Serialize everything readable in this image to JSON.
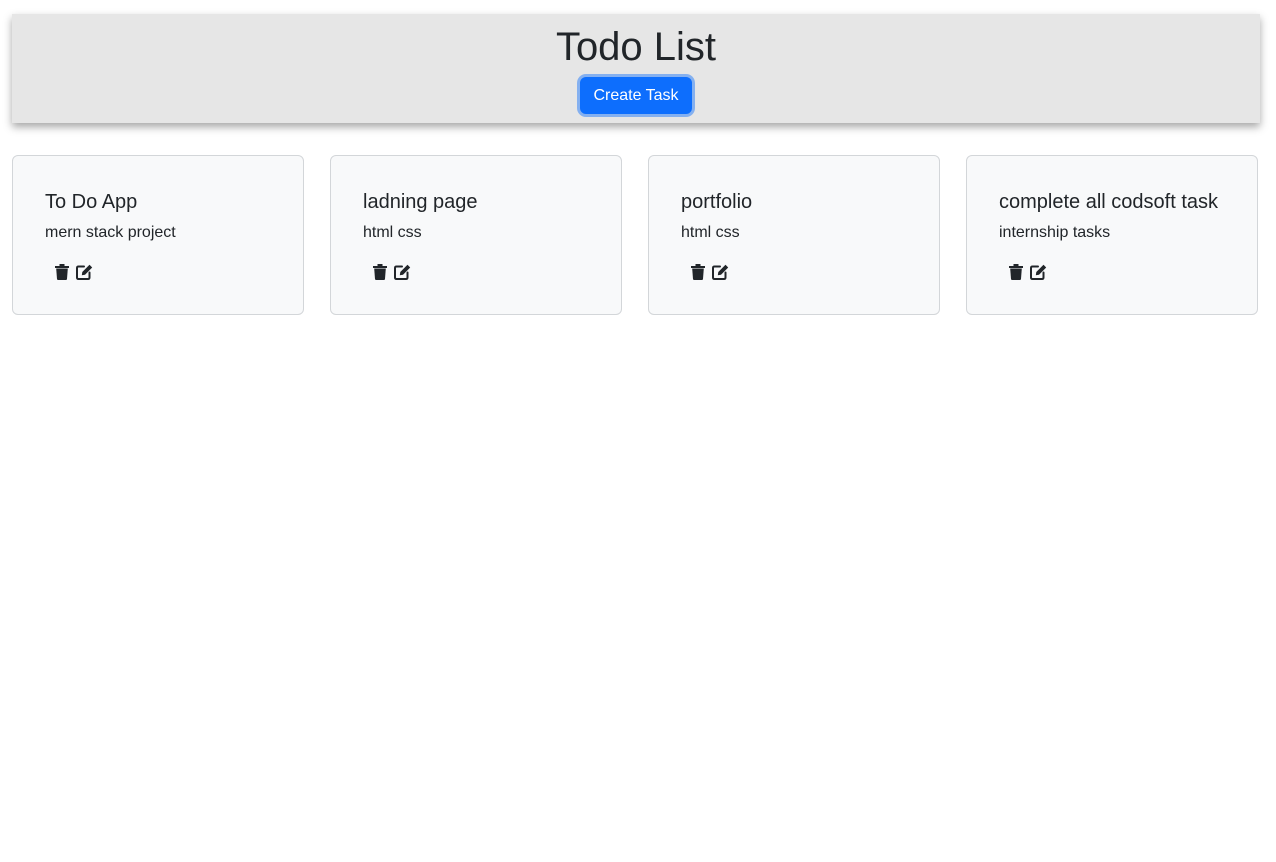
{
  "header": {
    "title": "Todo List",
    "create_button_label": "Create Task"
  },
  "tasks": [
    {
      "title": "To Do App",
      "description": "mern stack project",
      "delete_icon": "trash-icon",
      "edit_icon": "edit-icon"
    },
    {
      "title": "ladning page",
      "description": "html css",
      "delete_icon": "trash-icon",
      "edit_icon": "edit-icon"
    },
    {
      "title": "portfolio",
      "description": "html css",
      "delete_icon": "trash-icon",
      "edit_icon": "edit-icon"
    },
    {
      "title": "complete all codsoft task",
      "description": "internship tasks",
      "delete_icon": "trash-icon",
      "edit_icon": "edit-icon"
    }
  ],
  "colors": {
    "header_bg": "#e6e6e6",
    "primary": "#0d6efd",
    "card_bg": "#f8f9fa",
    "text": "#212529"
  }
}
